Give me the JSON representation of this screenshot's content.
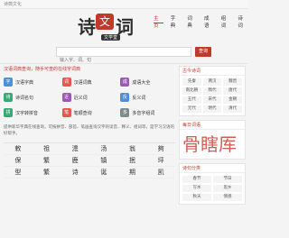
{
  "topbar": {
    "site_name": "诗典文化"
  },
  "logo": {
    "char1": "诗",
    "seal": "文",
    "char3": "词",
    "subtitle": "文学堂"
  },
  "nav": {
    "items": [
      {
        "label": "主页",
        "active": true
      },
      {
        "label": "字典",
        "active": false
      },
      {
        "label": "词典",
        "active": false
      },
      {
        "label": "成语",
        "active": false
      },
      {
        "label": "组词",
        "active": false
      },
      {
        "label": "诗词",
        "active": false
      }
    ]
  },
  "search": {
    "placeholder": "输入字、词、句",
    "button": "查询"
  },
  "main": {
    "notice": "汉语词典查询，随手可查的在线字词典",
    "cards": [
      {
        "label": "汉语字典",
        "icon": "字",
        "color": "#4a8fd8"
      },
      {
        "label": "汉语词典",
        "icon": "词",
        "color": "#e05a4f"
      },
      {
        "label": "成语大全",
        "icon": "成",
        "color": "#9b59b6"
      },
      {
        "label": "诗词名句",
        "icon": "诗",
        "color": "#3ba776"
      },
      {
        "label": "近义词",
        "icon": "近",
        "color": "#9b59b6"
      },
      {
        "label": "反义词",
        "icon": "反",
        "color": "#4a8fd8"
      },
      {
        "label": "汉字转拼音",
        "icon": "拼",
        "color": "#3ba776"
      },
      {
        "label": "笔顺查询",
        "icon": "笔",
        "color": "#e05a4f"
      },
      {
        "label": "多音字组词",
        "icon": "多",
        "color": "#7f8c8d"
      }
    ],
    "intro": "提供新华字典在线查询，可按拼音、部首、笔画查询汉字的读音、释义、组词等，是学习汉语的好帮手。",
    "chars": [
      "敕",
      "祖",
      "漶",
      "汤",
      "翁",
      "夠",
      "保",
      "繁",
      "鹿",
      "镇",
      "抿",
      "坪",
      "型",
      "繁",
      "诗",
      "诞",
      "期",
      "凯"
    ]
  },
  "side": {
    "dynasty_title": "古今诗词",
    "dynasties": [
      "先秦",
      "两汉",
      "魏晋",
      "南北朝",
      "隋代",
      "唐代",
      "五代",
      "宋代",
      "金朝",
      "元代",
      "明代",
      "清代"
    ],
    "daily_title": "每日词语",
    "daily_word": "骨瞎厍",
    "category_title": "诗句分类",
    "categories": [
      "春节",
      "节日",
      "写水",
      "思乡",
      "秋天",
      "情感"
    ]
  },
  "colors": {
    "accent": "#c0392b"
  }
}
